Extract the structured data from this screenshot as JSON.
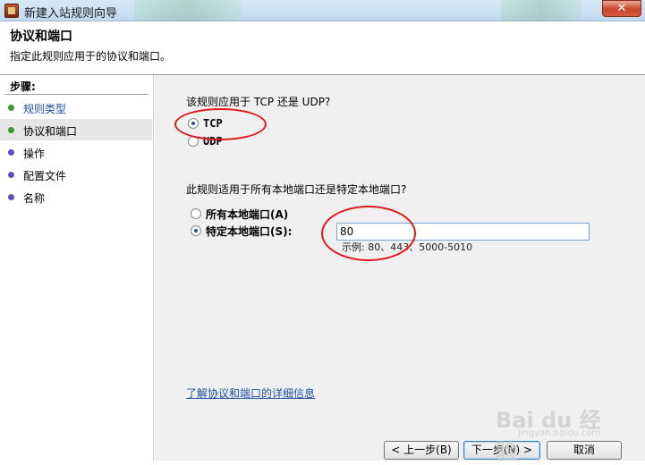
{
  "window": {
    "title": "新建入站规则向导",
    "close_label": "✕"
  },
  "header": {
    "title": "协议和端口",
    "subtitle": "指定此规则应用于的协议和端口。"
  },
  "sidebar": {
    "heading": "步骤:",
    "items": [
      {
        "label": "规则类型",
        "state": "done",
        "color": "#3a9a2a"
      },
      {
        "label": "协议和端口",
        "state": "active",
        "color": "#3a9a2a"
      },
      {
        "label": "操作",
        "state": "pending",
        "color": "#5b4fc7"
      },
      {
        "label": "配置文件",
        "state": "pending",
        "color": "#5b4fc7"
      },
      {
        "label": "名称",
        "state": "pending",
        "color": "#5b4fc7"
      }
    ]
  },
  "main": {
    "protocol_question": "该规则应用于 TCP 还是 UDP?",
    "protocol_options": [
      {
        "label": "TCP",
        "checked": true
      },
      {
        "label": "UDP",
        "checked": false
      }
    ],
    "port_question": "此规则适用于所有本地端口还是特定本地端口?",
    "port_options": [
      {
        "label": "所有本地端口(A)",
        "checked": false
      },
      {
        "label": "特定本地端口(S):",
        "checked": true
      }
    ],
    "port_value": "80",
    "port_example": "示例: 80、443、5000-5010",
    "learn_more_link": "了解协议和端口的详细信息"
  },
  "buttons": {
    "back": "< 上一步(B)",
    "next": "下一步(N) >",
    "cancel": "取消"
  },
  "watermark": {
    "text": "Bai du 经验",
    "sub": "jingyan.baidu.com"
  },
  "colors": {
    "annotation": "#e01818",
    "link": "#1f4fa6"
  }
}
